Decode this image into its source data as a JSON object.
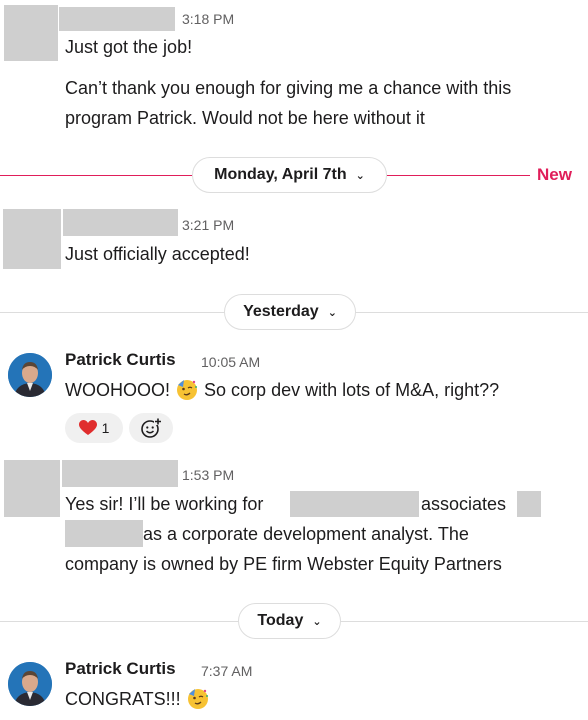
{
  "messages": [
    {
      "time": "3:18 PM",
      "lines": [
        "Just got the job!"
      ]
    },
    {
      "lines": [
        "Can’t thank you enough for giving me a chance with this",
        "program Patrick. Would not be here without it"
      ]
    },
    {
      "time": "3:21 PM",
      "lines": [
        "Just officially accepted!"
      ]
    },
    {
      "author": "Patrick Curtis",
      "time": "10:05 AM",
      "text_before": "WOOHOOO!",
      "text_after": "So corp dev with lots of M&A, right??",
      "reaction": {
        "emoji": "heart",
        "count": "1"
      }
    },
    {
      "time": "1:53 PM",
      "line1_a": "Yes sir! I’ll be working for",
      "line1_b": "associates",
      "line2_b": "as a corporate development analyst. The",
      "line3": "company is owned by PE firm Webster Equity Partners"
    },
    {
      "author": "Patrick Curtis",
      "time": "7:37 AM",
      "text": "CONGRATS!!!"
    }
  ],
  "dividers": {
    "new_date": "Monday, April 7th",
    "new_label": "New",
    "yesterday": "Yesterday",
    "today": "Today"
  },
  "icons": {
    "party_emoji": "partying-face-icon",
    "add_reaction": "add-reaction-icon",
    "chevron": "chevron-down-icon"
  },
  "colors": {
    "new_line": "#e01e5a",
    "divider": "#dddddd",
    "redaction": "#cfcfcf"
  }
}
